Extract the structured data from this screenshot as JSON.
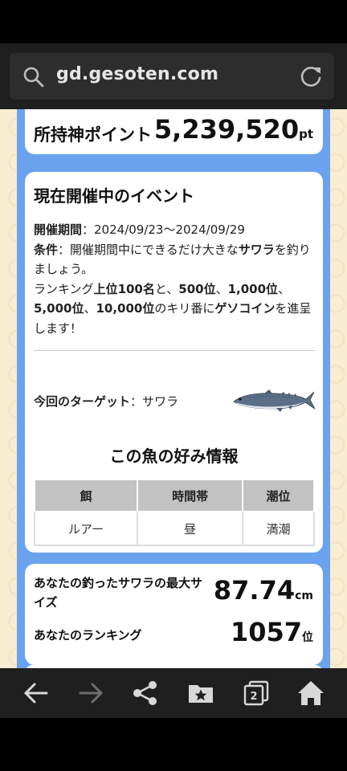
{
  "browser": {
    "url": "gd.gesoten.com"
  },
  "points": {
    "label": "所持神ポイント",
    "value": "5,239,520",
    "unit": "pt"
  },
  "event": {
    "title": "現在開催中のイベント",
    "period_label": "開催期間",
    "period_value": "：2024/09/23～2024/09/29",
    "condition_label": "条件",
    "condition_pre": "：開催期間中にできるだけ大きな",
    "condition_fish": "サワラ",
    "condition_post": "を釣りましょう。",
    "ranking_pre": "ランキング",
    "ranking_top": "上位100名",
    "ranking_and": "と、",
    "ranking_500": "500位",
    "sep1": "、",
    "ranking_1000": "1,000位",
    "sep2": "、",
    "ranking_5000": "5,000位",
    "sep3": "、",
    "ranking_10000": "10,000位",
    "ranking_mid": "のキリ番に",
    "ranking_coin": "ゲソコイン",
    "ranking_post": "を進呈します！",
    "target_label": "今回のターゲット",
    "target_value": "：サワラ"
  },
  "preference": {
    "title": "この魚の好み情報",
    "headers": [
      "餌",
      "時間帯",
      "潮位"
    ],
    "values": [
      "ルアー",
      "昼",
      "満潮"
    ]
  },
  "result": {
    "size_label": "あなたの釣ったサワラの最大サイズ",
    "size_value": "87.74",
    "size_unit": "cm",
    "rank_label": "あなたのランキング",
    "rank_value": "1057",
    "rank_unit": "位"
  },
  "nav": {
    "tab_count": "2"
  },
  "colors": {
    "frame_blue": "#6aa2ee",
    "background": "#f8ecd2",
    "table_header": "#c2c2c2"
  }
}
